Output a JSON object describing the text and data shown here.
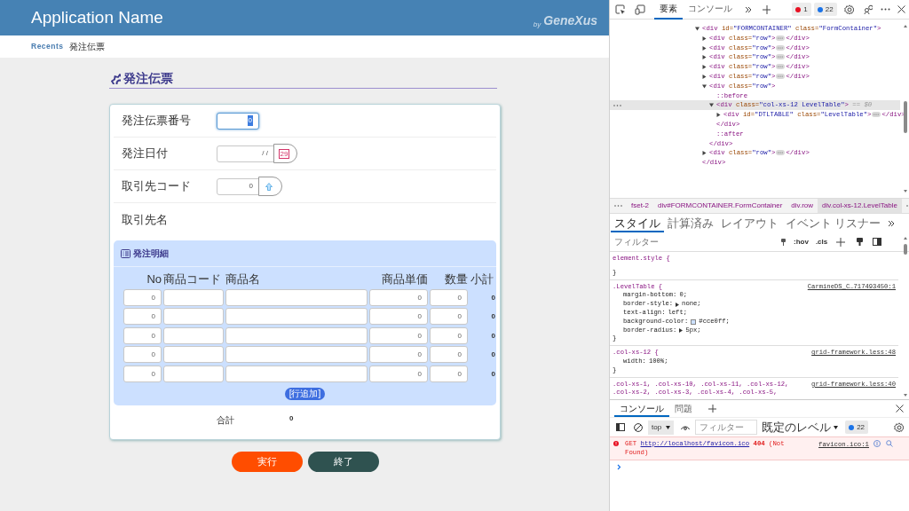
{
  "app": {
    "title": "Application Name",
    "brand_prefix": "by",
    "brand_name": "GeneXus"
  },
  "breadcrumb": [
    {
      "label": "Recents",
      "kind": "link"
    },
    {
      "label": "発注伝票",
      "kind": "current"
    }
  ],
  "page_title": "発注伝票",
  "fields": [
    {
      "label": "発注伝票番号",
      "kind": "number",
      "value": "0",
      "focused": true
    },
    {
      "label": "発注日付",
      "kind": "date",
      "value": "/ /",
      "calendar_day": "29",
      "focused": false
    },
    {
      "label": "取引先コード",
      "kind": "prompt",
      "value": "0",
      "focused": false
    },
    {
      "label": "取引先名",
      "kind": "display"
    }
  ],
  "detail": {
    "title": "発注明細",
    "columns": [
      "No",
      "商品コード",
      "商品名",
      "商品単価",
      "数量",
      "小計"
    ],
    "rows": [
      {
        "no": "0",
        "price": "0",
        "qty": "0",
        "subtotal": "0"
      },
      {
        "no": "0",
        "price": "0",
        "qty": "0",
        "subtotal": "0"
      },
      {
        "no": "0",
        "price": "0",
        "qty": "0",
        "subtotal": "0"
      },
      {
        "no": "0",
        "price": "0",
        "qty": "0",
        "subtotal": "0"
      },
      {
        "no": "0",
        "price": "0",
        "qty": "0",
        "subtotal": "0"
      }
    ],
    "add_button": "[行追加]"
  },
  "total": {
    "label": "合計",
    "value": "0"
  },
  "buttons": [
    {
      "label": "実行",
      "kind": "primary"
    },
    {
      "label": "終了",
      "kind": "secondary"
    }
  ],
  "devtools": {
    "tabs": [
      {
        "label": "要素",
        "selected": true
      },
      {
        "label": "コンソール",
        "selected": false
      }
    ],
    "error_count": "1",
    "info_count": "22",
    "dom": {
      "kind": "element",
      "open": "<div id=\"FORMCONTAINER\" class=\"FormContainer\">",
      "close": "</div>",
      "expanded": true,
      "selected": false,
      "children": [
        {
          "kind": "element",
          "open": "<div class=\"row\">",
          "close": "</div>",
          "expanded": false,
          "selected": false
        },
        {
          "kind": "element",
          "open": "<div class=\"row\">",
          "close": "</div>",
          "expanded": false,
          "selected": false
        },
        {
          "kind": "element",
          "open": "<div class=\"row\">",
          "close": "</div>",
          "expanded": false,
          "selected": false
        },
        {
          "kind": "element",
          "open": "<div class=\"row\">",
          "close": "</div>",
          "expanded": false,
          "selected": false
        },
        {
          "kind": "element",
          "open": "<div class=\"row\">",
          "close": "</div>",
          "expanded": false,
          "selected": false
        },
        {
          "kind": "element",
          "open": "<div class=\"row\">",
          "close": "</div>",
          "expanded": true,
          "selected": false,
          "children": [
            {
              "kind": "pseudo",
              "text": "::before",
              "selected": false
            },
            {
              "kind": "element",
              "open": "<div class=\"col-xs-12 LevelTable\">",
              "note": "== $0",
              "close": "</div>",
              "expanded": true,
              "selected": true,
              "children": [
                {
                  "kind": "element",
                  "open": "<div id=\"DTLTABLE\" class=\"LevelTable\">",
                  "close": "</div>",
                  "expanded": false,
                  "selected": false
                }
              ]
            },
            {
              "kind": "pseudo",
              "text": "::after",
              "selected": false
            }
          ]
        },
        {
          "kind": "element",
          "open": "<div class=\"row\">",
          "close": "</div>",
          "expanded": false,
          "selected": false
        }
      ]
    },
    "crumbs": [
      {
        "label": "fset-2",
        "selected": false
      },
      {
        "label": "div#FORMCONTAINER.FormContainer",
        "selected": false
      },
      {
        "label": "div.row",
        "selected": false
      },
      {
        "label": "div.col-xs-12.LevelTable",
        "selected": true
      }
    ],
    "style_tabs": [
      {
        "label": "スタイル",
        "selected": true
      },
      {
        "label": "計算済み",
        "selected": false
      },
      {
        "label": "レイアウト",
        "selected": false
      },
      {
        "label": "イベント リスナー",
        "selected": false
      }
    ],
    "filter_placeholder": "フィルター",
    "hov": ":hov",
    "cls": ".cls",
    "rules": [
      {
        "selector": "element.style {",
        "close": "}"
      },
      {
        "selector": ".LevelTable {",
        "source": "CarmineDS_C…717493450:1",
        "close": "}",
        "props": [
          {
            "name": "margin-bottom:",
            "value": "0;"
          },
          {
            "name": "border-style:",
            "value": "none;",
            "expandable": true
          },
          {
            "name": "text-align:",
            "value": "left;"
          },
          {
            "name": "background-color:",
            "value": "#cce0ff;",
            "swatch": true
          },
          {
            "name": "border-radius:",
            "value": "5px;",
            "expandable": true
          }
        ]
      },
      {
        "selector": ".col-xs-12 {",
        "source": "grid-framework.less:48",
        "close": "}",
        "props": [
          {
            "name": "width:",
            "value": "100%;"
          }
        ]
      },
      {
        "selector": ".col-xs-1, .col-xs-10, .col-xs-11, .col-xs-12, .col-xs-2, .col-xs-3, .col-xs-4, .col-xs-5,",
        "source": "grid-framework.less:40"
      }
    ],
    "console": {
      "tabs": [
        {
          "label": "コンソール",
          "selected": true
        },
        {
          "label": "問題",
          "selected": false
        }
      ],
      "context": "top",
      "filter_placeholder": "フィルター",
      "level": "既定のレベル",
      "count": "22",
      "message": {
        "kind": "error",
        "method": "GET",
        "url": "http://localhost/favicon.ico",
        "status": "404",
        "status_text": "(Not Found)",
        "source": "favicon.ico:1"
      }
    }
  }
}
